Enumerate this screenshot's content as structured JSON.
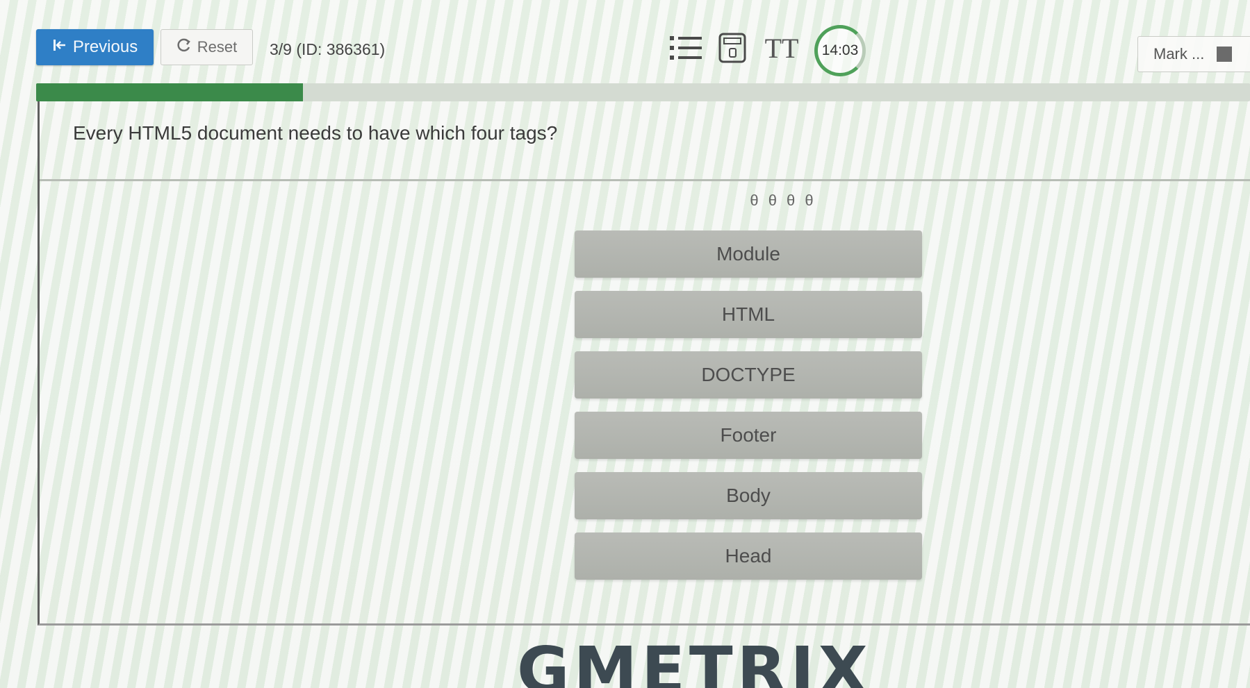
{
  "toolbar": {
    "previous_label": "Previous",
    "reset_label": "Reset",
    "question_counter": "3/9 (ID: 386361)",
    "timer": "14:03",
    "mark_label": "Mark ..."
  },
  "icons": {
    "previous": "skip-back-icon",
    "reset": "reset-icon",
    "question_list": "list-icon",
    "calculator": "calculator-icon",
    "text_size": "text-size-icon",
    "mark": "flag-icon"
  },
  "text_size_glyph": "TT",
  "progress": {
    "fraction": 0.22,
    "color": "#3b8a4a"
  },
  "question": {
    "text": "Every HTML5 document needs to have which four tags?",
    "slots": "θ θ θ θ",
    "options": [
      "Module",
      "HTML",
      "DOCTYPE",
      "Footer",
      "Body",
      "Head"
    ]
  },
  "brand": {
    "logo_text": "GMETRIX"
  },
  "colors": {
    "primary_button": "#2f7fc6",
    "progress": "#3b8a4a",
    "option_bg": "#b4b6b1"
  }
}
